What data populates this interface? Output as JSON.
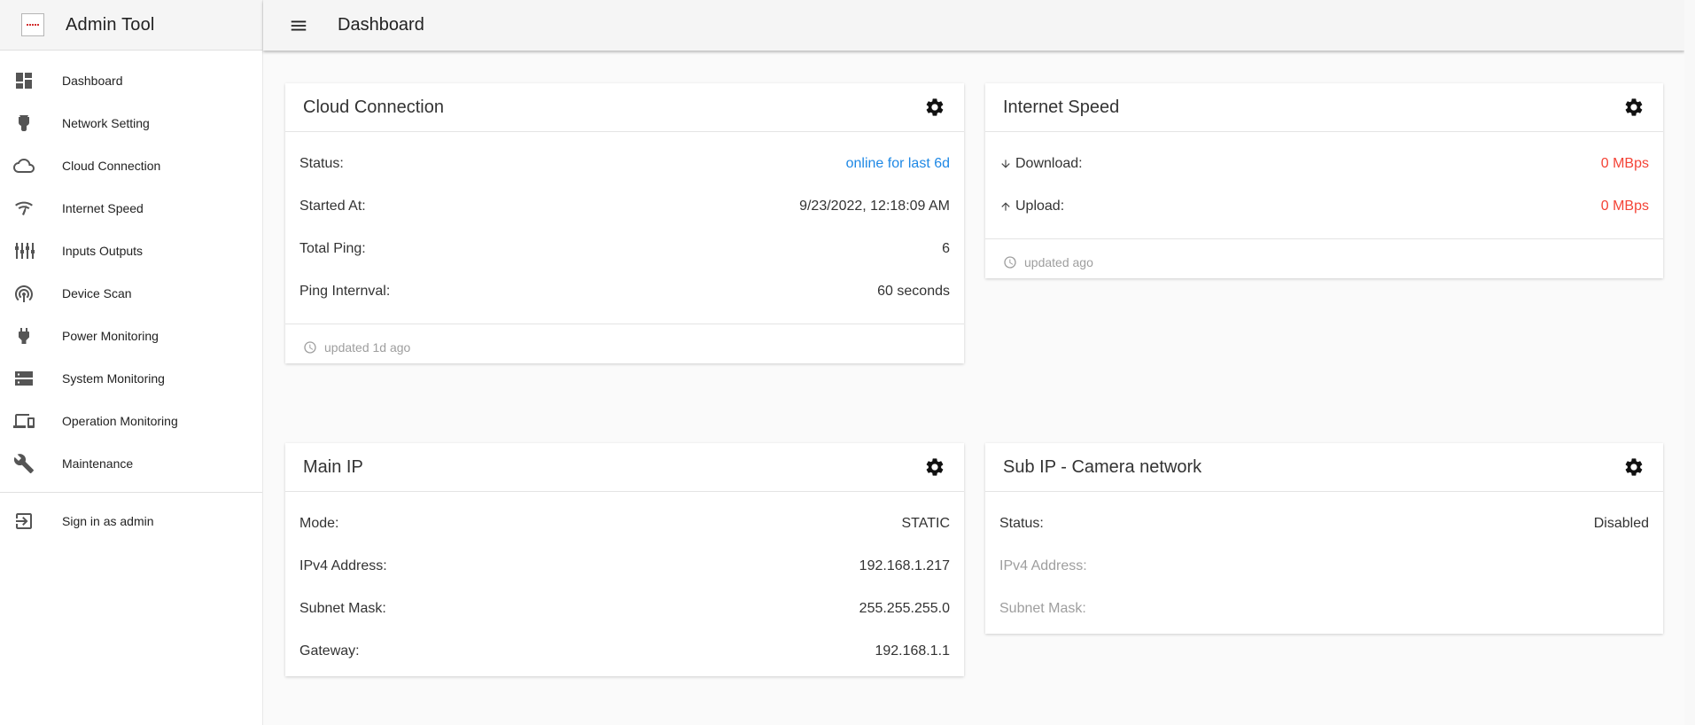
{
  "app": {
    "title": "Admin Tool"
  },
  "header": {
    "title": "Dashboard"
  },
  "sidebar": {
    "items": [
      {
        "label": "Dashboard",
        "icon": "dashboard-icon"
      },
      {
        "label": "Network Setting",
        "icon": "network-icon"
      },
      {
        "label": "Cloud Connection",
        "icon": "cloud-icon"
      },
      {
        "label": "Internet Speed",
        "icon": "speed-icon"
      },
      {
        "label": "Inputs Outputs",
        "icon": "io-icon"
      },
      {
        "label": "Device Scan",
        "icon": "scan-icon"
      },
      {
        "label": "Power Monitoring",
        "icon": "plug-icon"
      },
      {
        "label": "System Monitoring",
        "icon": "server-icon"
      },
      {
        "label": "Operation Monitoring",
        "icon": "devices-icon"
      },
      {
        "label": "Maintenance",
        "icon": "wrench-icon"
      }
    ],
    "signin": {
      "label": "Sign in as admin",
      "icon": "signin-icon"
    }
  },
  "cloud": {
    "title": "Cloud Connection",
    "rows": [
      {
        "label": "Status:",
        "value": "online for last 6d"
      },
      {
        "label": "Started At:",
        "value": "9/23/2022, 12:18:09 AM"
      },
      {
        "label": "Total Ping:",
        "value": "6"
      },
      {
        "label": "Ping Internval:",
        "value": "60 seconds"
      }
    ],
    "footer": "updated 1d ago"
  },
  "speed": {
    "title": "Internet Speed",
    "rows": [
      {
        "label": "Download:",
        "value": "0 MBps"
      },
      {
        "label": "Upload:",
        "value": "0 MBps"
      }
    ],
    "footer": "updated ago"
  },
  "main_ip": {
    "title": "Main IP",
    "rows": [
      {
        "label": "Mode:",
        "value": "STATIC"
      },
      {
        "label": "IPv4 Address:",
        "value": "192.168.1.217"
      },
      {
        "label": "Subnet Mask:",
        "value": "255.255.255.0"
      },
      {
        "label": "Gateway:",
        "value": "192.168.1.1"
      }
    ]
  },
  "sub_ip": {
    "title": "Sub IP - Camera network",
    "rows": [
      {
        "label": "Status:",
        "value": "Disabled"
      },
      {
        "label": "IPv4 Address:",
        "value": ""
      },
      {
        "label": "Subnet Mask:",
        "value": ""
      }
    ]
  },
  "colors": {
    "accent": "#1e88e5",
    "alert": "#f44336",
    "muted": "#9e9e9e"
  }
}
